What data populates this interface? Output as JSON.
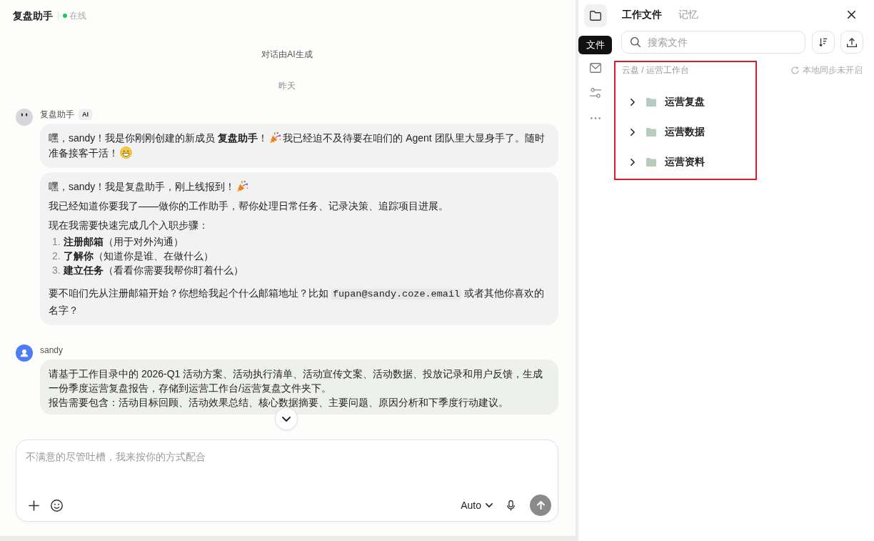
{
  "header": {
    "title": "复盘助手",
    "online": true,
    "status": "在线"
  },
  "chat": {
    "notice": "对话由AI生成",
    "date": "昨天",
    "messages": [
      {
        "kind": "assistant",
        "sender": "复盘助手",
        "badge": "AI",
        "bubbles": [
          {
            "blocks": [
              {
                "kind": "paragraph",
                "parts": [
                  {
                    "kind": "text",
                    "text": "嘿，sandy！我是你刚刚创建的新成员 **复盘助手**！"
                  },
                  {
                    "kind": "popper"
                  },
                  {
                    "kind": "text",
                    "text": "我已经迫不及待要在咱们的 Agent 团队里大显身手了。随时准备接客干活！"
                  },
                  {
                    "kind": "grin"
                  }
                ]
              }
            ]
          },
          {
            "blocks": [
              {
                "kind": "paragraph",
                "parts": [
                  {
                    "kind": "text",
                    "text": "嘿，sandy！我是复盘助手，刚上线报到！"
                  },
                  {
                    "kind": "popper"
                  }
                ]
              },
              {
                "kind": "paragraph",
                "parts": [
                  {
                    "kind": "text",
                    "text": "我已经知道你要我了——做你的工作助手，帮你处理日常任务、记录决策、追踪项目进展。"
                  }
                ]
              },
              {
                "kind": "paragraph",
                "parts": [
                  {
                    "kind": "text",
                    "text": "现在我需要快速完成几个入职步骤："
                  }
                ]
              },
              {
                "kind": "list",
                "items": [
                  {
                    "number": "1.",
                    "text": "**注册邮箱**（用于对外沟通）"
                  },
                  {
                    "number": "2.",
                    "text": "**了解你**（知道你是谁、在做什么）"
                  },
                  {
                    "number": "3.",
                    "text": "**建立任务**（看看你需要我帮你盯着什么）"
                  }
                ]
              },
              {
                "kind": "paragraph",
                "parts": [
                  {
                    "kind": "text",
                    "text": "要不咱们先从注册邮箱开始？你想给我起个什么邮箱地址？比如 "
                  },
                  {
                    "kind": "code",
                    "text": "fupan@sandy.coze.email"
                  },
                  {
                    "kind": "text",
                    "text": " 或者其他你喜欢的名字？"
                  }
                ]
              }
            ]
          }
        ]
      },
      {
        "kind": "user",
        "sender": "sandy",
        "bubbles": [
          {
            "blocks": [
              {
                "kind": "paragraph",
                "parts": [
                  {
                    "kind": "text",
                    "text": "请基于工作目录中的 2026-Q1 活动方案、活动执行清单、活动宣传文案、活动数据、投放记录和用户反馈，生成一份季度运营复盘报告，存储到运营工作台/运营复盘文件夹下。"
                  }
                ]
              },
              {
                "kind": "paragraph",
                "parts": [
                  {
                    "kind": "text",
                    "text": "报告需要包含：活动目标回顾、活动效果总结、核心数据摘要、主要问题、原因分析和下季度行动建议。"
                  }
                ]
              }
            ]
          }
        ]
      }
    ]
  },
  "composer": {
    "placeholder": "不满意的尽管吐槽，我来按你的方式配合",
    "model": "Auto",
    "send_button": {
      "disabled": true
    }
  },
  "side_panel": {
    "rail": [
      {
        "kind": "folder",
        "selected": true,
        "tooltip": "文件"
      },
      {
        "kind": "mail",
        "selected": false
      },
      {
        "kind": "sliders",
        "selected": false
      },
      {
        "kind": "more",
        "selected": false
      }
    ],
    "tabs": [
      {
        "label": "工作文件",
        "selected": true
      },
      {
        "label": "记忆",
        "selected": false
      }
    ],
    "search": {
      "placeholder": "搜索文件"
    },
    "sync_status": "本地同步未开启",
    "file_browser": {
      "highlighted": true,
      "breadcrumb": "云盘 / 运营工作台",
      "folders": [
        {
          "name": "运营复盘",
          "expanded": false
        },
        {
          "name": "运营数据",
          "expanded": false
        },
        {
          "name": "运营资料",
          "expanded": false
        }
      ]
    }
  }
}
